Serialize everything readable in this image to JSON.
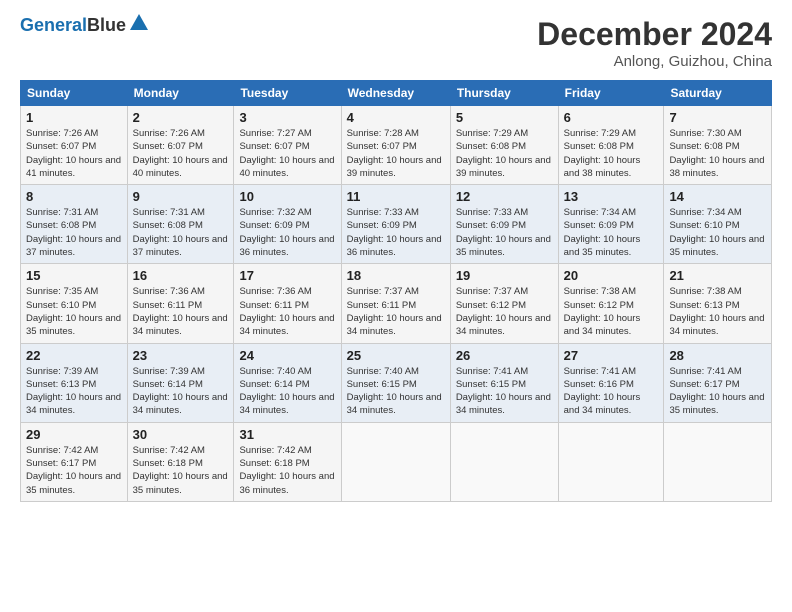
{
  "header": {
    "logo_line1": "General",
    "logo_line2": "Blue",
    "title": "December 2024",
    "subtitle": "Anlong, Guizhou, China"
  },
  "weekdays": [
    "Sunday",
    "Monday",
    "Tuesday",
    "Wednesday",
    "Thursday",
    "Friday",
    "Saturday"
  ],
  "weeks": [
    [
      {
        "day": "1",
        "sunrise": "Sunrise: 7:26 AM",
        "sunset": "Sunset: 6:07 PM",
        "daylight": "Daylight: 10 hours and 41 minutes."
      },
      {
        "day": "2",
        "sunrise": "Sunrise: 7:26 AM",
        "sunset": "Sunset: 6:07 PM",
        "daylight": "Daylight: 10 hours and 40 minutes."
      },
      {
        "day": "3",
        "sunrise": "Sunrise: 7:27 AM",
        "sunset": "Sunset: 6:07 PM",
        "daylight": "Daylight: 10 hours and 40 minutes."
      },
      {
        "day": "4",
        "sunrise": "Sunrise: 7:28 AM",
        "sunset": "Sunset: 6:07 PM",
        "daylight": "Daylight: 10 hours and 39 minutes."
      },
      {
        "day": "5",
        "sunrise": "Sunrise: 7:29 AM",
        "sunset": "Sunset: 6:08 PM",
        "daylight": "Daylight: 10 hours and 39 minutes."
      },
      {
        "day": "6",
        "sunrise": "Sunrise: 7:29 AM",
        "sunset": "Sunset: 6:08 PM",
        "daylight": "Daylight: 10 hours and 38 minutes."
      },
      {
        "day": "7",
        "sunrise": "Sunrise: 7:30 AM",
        "sunset": "Sunset: 6:08 PM",
        "daylight": "Daylight: 10 hours and 38 minutes."
      }
    ],
    [
      {
        "day": "8",
        "sunrise": "Sunrise: 7:31 AM",
        "sunset": "Sunset: 6:08 PM",
        "daylight": "Daylight: 10 hours and 37 minutes."
      },
      {
        "day": "9",
        "sunrise": "Sunrise: 7:31 AM",
        "sunset": "Sunset: 6:08 PM",
        "daylight": "Daylight: 10 hours and 37 minutes."
      },
      {
        "day": "10",
        "sunrise": "Sunrise: 7:32 AM",
        "sunset": "Sunset: 6:09 PM",
        "daylight": "Daylight: 10 hours and 36 minutes."
      },
      {
        "day": "11",
        "sunrise": "Sunrise: 7:33 AM",
        "sunset": "Sunset: 6:09 PM",
        "daylight": "Daylight: 10 hours and 36 minutes."
      },
      {
        "day": "12",
        "sunrise": "Sunrise: 7:33 AM",
        "sunset": "Sunset: 6:09 PM",
        "daylight": "Daylight: 10 hours and 35 minutes."
      },
      {
        "day": "13",
        "sunrise": "Sunrise: 7:34 AM",
        "sunset": "Sunset: 6:09 PM",
        "daylight": "Daylight: 10 hours and 35 minutes."
      },
      {
        "day": "14",
        "sunrise": "Sunrise: 7:34 AM",
        "sunset": "Sunset: 6:10 PM",
        "daylight": "Daylight: 10 hours and 35 minutes."
      }
    ],
    [
      {
        "day": "15",
        "sunrise": "Sunrise: 7:35 AM",
        "sunset": "Sunset: 6:10 PM",
        "daylight": "Daylight: 10 hours and 35 minutes."
      },
      {
        "day": "16",
        "sunrise": "Sunrise: 7:36 AM",
        "sunset": "Sunset: 6:11 PM",
        "daylight": "Daylight: 10 hours and 34 minutes."
      },
      {
        "day": "17",
        "sunrise": "Sunrise: 7:36 AM",
        "sunset": "Sunset: 6:11 PM",
        "daylight": "Daylight: 10 hours and 34 minutes."
      },
      {
        "day": "18",
        "sunrise": "Sunrise: 7:37 AM",
        "sunset": "Sunset: 6:11 PM",
        "daylight": "Daylight: 10 hours and 34 minutes."
      },
      {
        "day": "19",
        "sunrise": "Sunrise: 7:37 AM",
        "sunset": "Sunset: 6:12 PM",
        "daylight": "Daylight: 10 hours and 34 minutes."
      },
      {
        "day": "20",
        "sunrise": "Sunrise: 7:38 AM",
        "sunset": "Sunset: 6:12 PM",
        "daylight": "Daylight: 10 hours and 34 minutes."
      },
      {
        "day": "21",
        "sunrise": "Sunrise: 7:38 AM",
        "sunset": "Sunset: 6:13 PM",
        "daylight": "Daylight: 10 hours and 34 minutes."
      }
    ],
    [
      {
        "day": "22",
        "sunrise": "Sunrise: 7:39 AM",
        "sunset": "Sunset: 6:13 PM",
        "daylight": "Daylight: 10 hours and 34 minutes."
      },
      {
        "day": "23",
        "sunrise": "Sunrise: 7:39 AM",
        "sunset": "Sunset: 6:14 PM",
        "daylight": "Daylight: 10 hours and 34 minutes."
      },
      {
        "day": "24",
        "sunrise": "Sunrise: 7:40 AM",
        "sunset": "Sunset: 6:14 PM",
        "daylight": "Daylight: 10 hours and 34 minutes."
      },
      {
        "day": "25",
        "sunrise": "Sunrise: 7:40 AM",
        "sunset": "Sunset: 6:15 PM",
        "daylight": "Daylight: 10 hours and 34 minutes."
      },
      {
        "day": "26",
        "sunrise": "Sunrise: 7:41 AM",
        "sunset": "Sunset: 6:15 PM",
        "daylight": "Daylight: 10 hours and 34 minutes."
      },
      {
        "day": "27",
        "sunrise": "Sunrise: 7:41 AM",
        "sunset": "Sunset: 6:16 PM",
        "daylight": "Daylight: 10 hours and 34 minutes."
      },
      {
        "day": "28",
        "sunrise": "Sunrise: 7:41 AM",
        "sunset": "Sunset: 6:17 PM",
        "daylight": "Daylight: 10 hours and 35 minutes."
      }
    ],
    [
      {
        "day": "29",
        "sunrise": "Sunrise: 7:42 AM",
        "sunset": "Sunset: 6:17 PM",
        "daylight": "Daylight: 10 hours and 35 minutes."
      },
      {
        "day": "30",
        "sunrise": "Sunrise: 7:42 AM",
        "sunset": "Sunset: 6:18 PM",
        "daylight": "Daylight: 10 hours and 35 minutes."
      },
      {
        "day": "31",
        "sunrise": "Sunrise: 7:42 AM",
        "sunset": "Sunset: 6:18 PM",
        "daylight": "Daylight: 10 hours and 36 minutes."
      },
      null,
      null,
      null,
      null
    ]
  ]
}
